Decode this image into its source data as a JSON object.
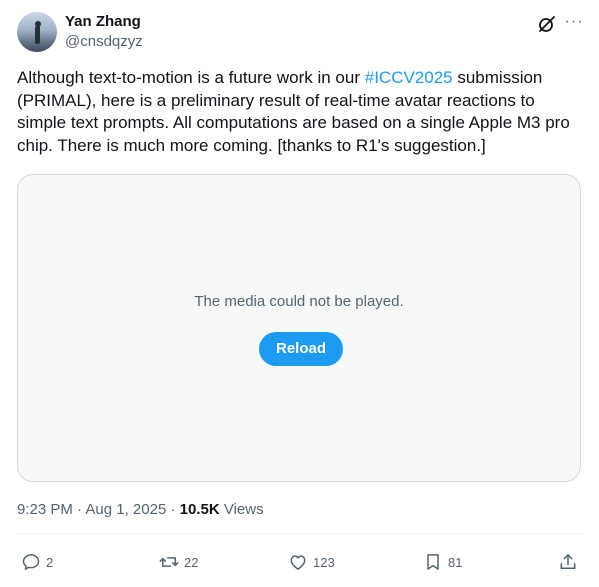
{
  "author": {
    "name": "Yan Zhang",
    "handle": "@cnsdqzyz"
  },
  "icons": {
    "grok": "grok-icon",
    "more": "more-icon",
    "reply": "reply-icon",
    "retweet": "retweet-icon",
    "like": "like-icon",
    "bookmark": "bookmark-icon",
    "share": "share-icon"
  },
  "tweet": {
    "text_before": "Although text-to-motion is a future work in our ",
    "hashtag": "#ICCV2025",
    "text_after": " submission (PRIMAL), here is a preliminary result of real-time avatar reactions to simple text prompts. All computations are based on a single Apple M3 pro chip. There is much more coming. [thanks to R1's suggestion.]"
  },
  "media": {
    "message": "The media could not be played.",
    "reload_label": "Reload"
  },
  "meta": {
    "time": "9:23 PM",
    "separator": " · ",
    "date": "Aug 1, 2025",
    "separator2": " · ",
    "views_count": "10.5K",
    "views_label": " Views"
  },
  "actions": {
    "replies": "2",
    "retweets": "22",
    "likes": "123",
    "bookmarks": "81"
  },
  "colors": {
    "accent": "#1d9bf0",
    "text": "#0f1419",
    "secondary": "#536471",
    "border": "#cfd9de"
  }
}
